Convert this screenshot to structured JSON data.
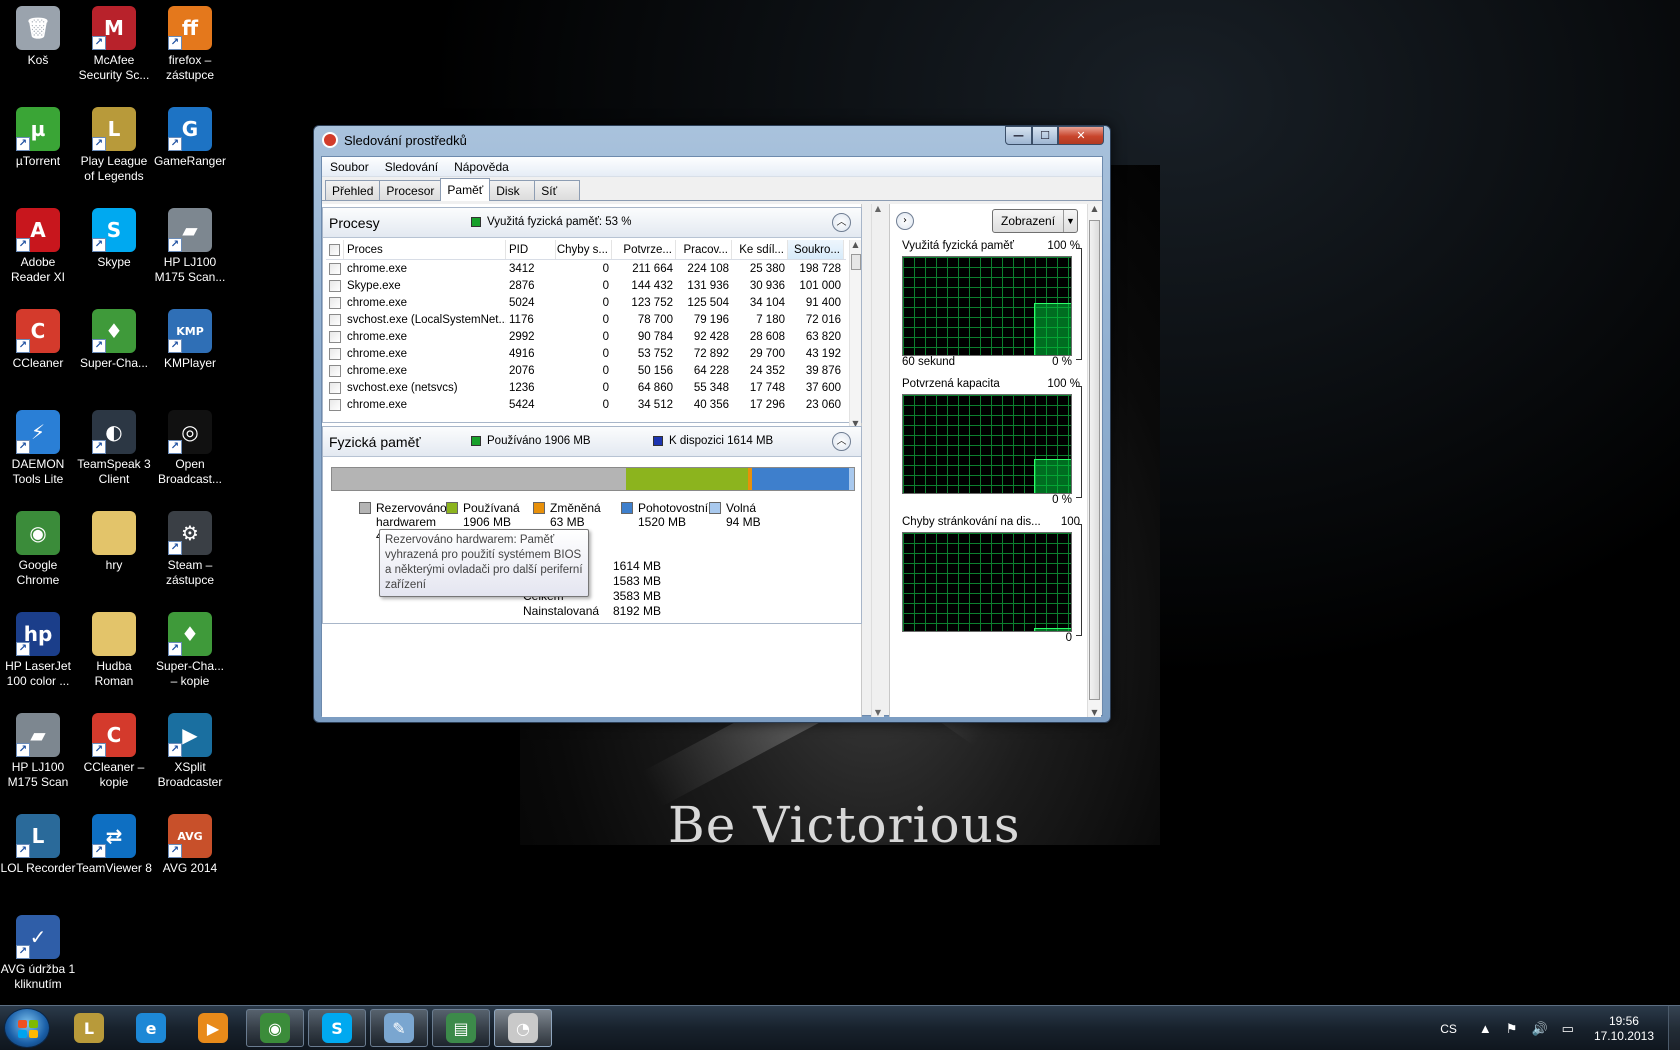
{
  "desktop": {
    "wallpaper_text": "Be Victorious",
    "icons": [
      {
        "label": "Koš",
        "icon": "recycle-bin-icon",
        "color": "#9aa3ad",
        "glyph": "🗑",
        "shortcut": false
      },
      {
        "label": "McAfee Security Sc...",
        "icon": "mcafee-icon",
        "color": "#b8222b",
        "glyph": "M",
        "shortcut": true
      },
      {
        "label": "firefox – zástupce",
        "icon": "firefox-icon",
        "color": "#e4781c",
        "glyph": "ff",
        "shortcut": true
      },
      {
        "label": "µTorrent",
        "icon": "utorrent-icon",
        "color": "#3aa536",
        "glyph": "µ",
        "shortcut": true
      },
      {
        "label": "Play League of Legends",
        "icon": "league-of-legends-icon",
        "color": "#b89a3a",
        "glyph": "L",
        "shortcut": true
      },
      {
        "label": "GameRanger",
        "icon": "gameranger-icon",
        "color": "#1d73c4",
        "glyph": "G",
        "shortcut": true
      },
      {
        "label": "Adobe Reader XI",
        "icon": "adobe-reader-icon",
        "color": "#c8161d",
        "glyph": "A",
        "shortcut": true
      },
      {
        "label": "Skype",
        "icon": "skype-icon",
        "color": "#00a9f0",
        "glyph": "S",
        "shortcut": true
      },
      {
        "label": "HP LJ100 M175 Scan...",
        "icon": "scanner-icon",
        "color": "#7d8790",
        "glyph": "▰",
        "shortcut": true
      },
      {
        "label": "CCleaner",
        "icon": "ccleaner-icon",
        "color": "#d43a2c",
        "glyph": "C",
        "shortcut": true
      },
      {
        "label": "Super-Cha...",
        "icon": "super-chart-icon",
        "color": "#3f9a3a",
        "glyph": "♦",
        "shortcut": true
      },
      {
        "label": "KMPlayer",
        "icon": "kmplayer-icon",
        "color": "#2f6fb6",
        "glyph": "KMP",
        "shortcut": true
      },
      {
        "label": "DAEMON Tools Lite",
        "icon": "daemon-tools-icon",
        "color": "#2a7fd6",
        "glyph": "⚡",
        "shortcut": true
      },
      {
        "label": "TeamSpeak 3 Client",
        "icon": "teamspeak-icon",
        "color": "#2c3744",
        "glyph": "◐",
        "shortcut": true
      },
      {
        "label": "Open Broadcast...",
        "icon": "obs-icon",
        "color": "#111111",
        "glyph": "◎",
        "shortcut": true
      },
      {
        "label": "Google Chrome",
        "icon": "chrome-icon",
        "color": "#3b8c3a",
        "glyph": "◉",
        "shortcut": false
      },
      {
        "label": "hry",
        "icon": "folder-icon",
        "color": "#e3c46a",
        "glyph": "",
        "shortcut": false
      },
      {
        "label": "Steam – zástupce",
        "icon": "steam-icon",
        "color": "#3a3f45",
        "glyph": "⚙",
        "shortcut": true
      },
      {
        "label": "HP LaserJet 100 color ...",
        "icon": "printer-icon",
        "color": "#1b3e8a",
        "glyph": "hp",
        "shortcut": true
      },
      {
        "label": "Hudba Roman",
        "icon": "folder-icon",
        "color": "#e3c46a",
        "glyph": "",
        "shortcut": false
      },
      {
        "label": "Super-Cha... – kopie",
        "icon": "super-chart-icon",
        "color": "#3f9a3a",
        "glyph": "♦",
        "shortcut": true
      },
      {
        "label": "HP LJ100 M175 Scan",
        "icon": "scanner-icon",
        "color": "#7d8790",
        "glyph": "▰",
        "shortcut": true
      },
      {
        "label": "CCleaner – kopie",
        "icon": "ccleaner-icon",
        "color": "#d43a2c",
        "glyph": "C",
        "shortcut": true
      },
      {
        "label": "XSplit Broadcaster",
        "icon": "xsplit-icon",
        "color": "#1a6fa0",
        "glyph": "▶",
        "shortcut": true
      },
      {
        "label": "LOL Recorder",
        "icon": "lol-recorder-icon",
        "color": "#2a6a9a",
        "glyph": "L",
        "shortcut": true
      },
      {
        "label": "TeamViewer 8",
        "icon": "teamviewer-icon",
        "color": "#0e6fc2",
        "glyph": "⇄",
        "shortcut": true
      },
      {
        "label": "AVG 2014",
        "icon": "avg-icon",
        "color": "#c8502a",
        "glyph": "AVG",
        "shortcut": true
      },
      {
        "label": "AVG údržba 1 kliknutím",
        "icon": "avg-tuneup-icon",
        "color": "#2f5ea8",
        "glyph": "✓",
        "shortcut": true
      }
    ]
  },
  "window": {
    "title": "Sledování prostředků",
    "buttons": {
      "minimize": "—",
      "maximize": "☐",
      "close": "✕"
    },
    "menu": [
      "Soubor",
      "Sledování",
      "Nápověda"
    ],
    "tabs": [
      "Přehled",
      "Procesor",
      "Paměť",
      "Disk",
      "Síť"
    ],
    "active_tab": "Paměť",
    "processes": {
      "title": "Procesy",
      "info": "Využitá fyzická paměť: 53 %",
      "info_color": "#17a02a",
      "columns": [
        "Proces",
        "PID",
        "Chyby s...",
        "Potvrze...",
        "Pracov...",
        "Ke sdíl...",
        "Soukro..."
      ],
      "rows": [
        [
          "chrome.exe",
          "3412",
          "0",
          "211 664",
          "224 108",
          "25 380",
          "198 728"
        ],
        [
          "Skype.exe",
          "2876",
          "0",
          "144 432",
          "131 936",
          "30 936",
          "101 000"
        ],
        [
          "chrome.exe",
          "5024",
          "0",
          "123 752",
          "125 504",
          "34 104",
          "91 400"
        ],
        [
          "svchost.exe (LocalSystemNet...",
          "1176",
          "0",
          "78 700",
          "79 196",
          "7 180",
          "72 016"
        ],
        [
          "chrome.exe",
          "2992",
          "0",
          "90 784",
          "92 428",
          "28 608",
          "63 820"
        ],
        [
          "chrome.exe",
          "4916",
          "0",
          "53 752",
          "72 892",
          "29 700",
          "43 192"
        ],
        [
          "chrome.exe",
          "2076",
          "0",
          "50 156",
          "64 228",
          "24 352",
          "39 876"
        ],
        [
          "svchost.exe (netsvcs)",
          "1236",
          "0",
          "64 860",
          "55 348",
          "17 748",
          "37 600"
        ],
        [
          "chrome.exe",
          "5424",
          "0",
          "34 512",
          "40 356",
          "17 296",
          "23 060"
        ]
      ]
    },
    "physical": {
      "title": "Fyzická paměť",
      "used_info": "Používáno 1906 MB",
      "used_color": "#17a02a",
      "avail_info": "K dispozici 1614 MB",
      "avail_color": "#1c34b0",
      "bar": [
        {
          "name": "reserved",
          "fraction": 0.563,
          "color": "#b4b4b4"
        },
        {
          "name": "in-use",
          "fraction": 0.233,
          "color": "#8cb41e"
        },
        {
          "name": "modified",
          "fraction": 0.008,
          "color": "#e8900a"
        },
        {
          "name": "standby",
          "fraction": 0.186,
          "color": "#3e7fcc"
        },
        {
          "name": "free",
          "fraction": 0.01,
          "color": "#a9c9ee"
        }
      ],
      "legend": [
        {
          "label": "Rezervováno",
          "label2": "hardwarem",
          "value": "4",
          "color": "#b4b4b4"
        },
        {
          "label": "Používaná",
          "value": "1906 MB",
          "color": "#8cb41e"
        },
        {
          "label": "Změněná",
          "value": "63 MB",
          "color": "#e8900a"
        },
        {
          "label": "Pohotovostní",
          "value": "1520 MB",
          "color": "#3e7fcc"
        },
        {
          "label": "Volná",
          "value": "94 MB",
          "color": "#a9c9ee"
        }
      ],
      "stats": [
        {
          "k": "",
          "v": "1614 MB"
        },
        {
          "k": "",
          "v": "1583 MB"
        },
        {
          "k": "Celkem",
          "v": "3583 MB"
        },
        {
          "k": "Nainstalovaná",
          "v": "8192 MB"
        }
      ],
      "tooltip": "Rezervováno hardwarem: Paměť vyhrazená pro použití systémem BIOS a některými ovladači pro další periferní zařízení"
    },
    "graphs_panel": {
      "view_button": "Zobrazení",
      "graphs": [
        {
          "title": "Využitá fyzická paměť",
          "max": "100 %",
          "foot_left": "60 sekund",
          "foot_right": "0 %",
          "level": 0.53
        },
        {
          "title": "Potvrzená kapacita",
          "max": "100 %",
          "foot_left": "",
          "foot_right": "0 %",
          "level": 0.35
        },
        {
          "title": "Chyby stránkování na dis...",
          "max": "100",
          "foot_left": "",
          "foot_right": "0",
          "level": 0.03
        }
      ]
    }
  },
  "taskbar": {
    "items": [
      {
        "icon": "league-of-legends-icon",
        "color": "#b89a3a",
        "glyph": "L",
        "state": "pinned"
      },
      {
        "icon": "internet-explorer-icon",
        "color": "#1d88d6",
        "glyph": "e",
        "state": "pinned"
      },
      {
        "icon": "media-player-icon",
        "color": "#e88a1a",
        "glyph": "▶",
        "state": "pinned"
      },
      {
        "icon": "chrome-icon",
        "color": "#3b8c3a",
        "glyph": "◉",
        "state": "running"
      },
      {
        "icon": "skype-icon",
        "color": "#00a9f0",
        "glyph": "S",
        "state": "running"
      },
      {
        "icon": "paint-icon",
        "color": "#7aa6d0",
        "glyph": "✎",
        "state": "running"
      },
      {
        "icon": "task-manager-icon",
        "color": "#3c8a4a",
        "glyph": "▤",
        "state": "running"
      },
      {
        "icon": "resource-monitor-icon",
        "color": "#c9c9c9",
        "glyph": "◔",
        "state": "active"
      }
    ],
    "tray": {
      "lang": "CS",
      "time": "19:56",
      "date": "17.10.2013"
    }
  }
}
